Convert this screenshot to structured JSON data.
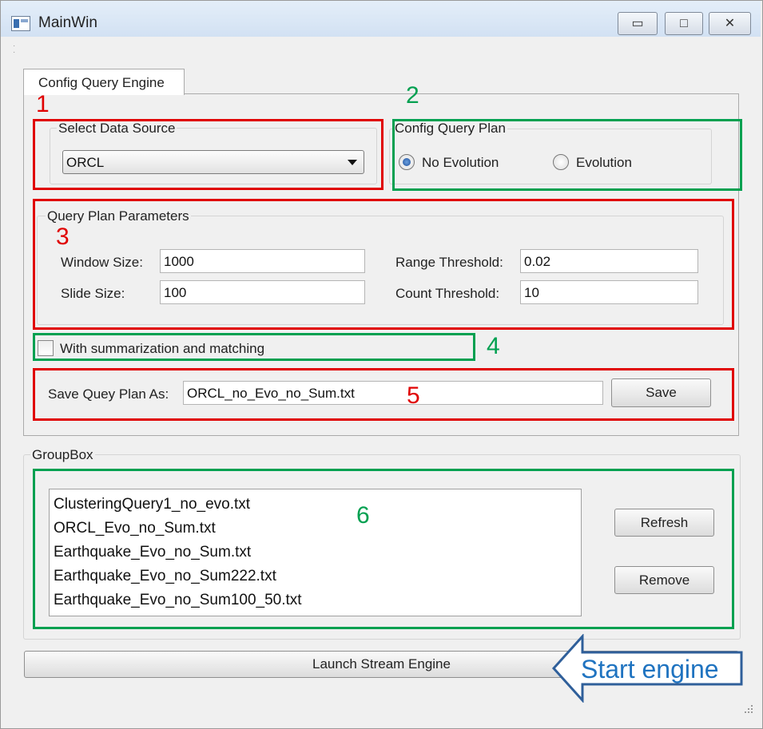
{
  "window": {
    "title": "MainWin"
  },
  "titlebar_buttons": {
    "minimize": "▭",
    "maximize": "□",
    "close": "✕"
  },
  "tabs": [
    {
      "label": "Config Query Engine"
    }
  ],
  "data_source": {
    "group_title": "Select Data Source",
    "selected": "ORCL"
  },
  "query_plan": {
    "group_title": "Config Query Plan",
    "options": [
      {
        "label": "No Evolution",
        "checked": true
      },
      {
        "label": "Evolution",
        "checked": false
      }
    ]
  },
  "parameters": {
    "group_title": "Query Plan Parameters",
    "window_size": {
      "label": "Window Size:",
      "value": "1000"
    },
    "slide_size": {
      "label": "Slide Size:",
      "value": "100"
    },
    "range_threshold": {
      "label": "Range Threshold:",
      "value": "0.02"
    },
    "count_threshold": {
      "label": "Count Threshold:",
      "value": "10"
    }
  },
  "summarization": {
    "label": "With summarization and matching",
    "checked": false
  },
  "save_plan": {
    "label": "Save Quey Plan As:",
    "value": "ORCL_no_Evo_no_Sum.txt",
    "button": "Save"
  },
  "groupbox": {
    "title": "GroupBox",
    "files": [
      "ClusteringQuery1_no_evo.txt",
      "ORCL_Evo_no_Sum.txt",
      "Earthquake_Evo_no_Sum.txt",
      "Earthquake_Evo_no_Sum222.txt",
      "Earthquake_Evo_no_Sum100_50.txt"
    ],
    "refresh_button": "Refresh",
    "remove_button": "Remove"
  },
  "launch_button": "Launch Stream Engine",
  "annotations": {
    "n1": "1",
    "n2": "2",
    "n3": "3",
    "n4": "4",
    "n5": "5",
    "n6": "6",
    "start_engine": "Start engine",
    "red_color": "#e00000",
    "green_color": "#00a050",
    "arrow_color": "#1f73c0"
  }
}
